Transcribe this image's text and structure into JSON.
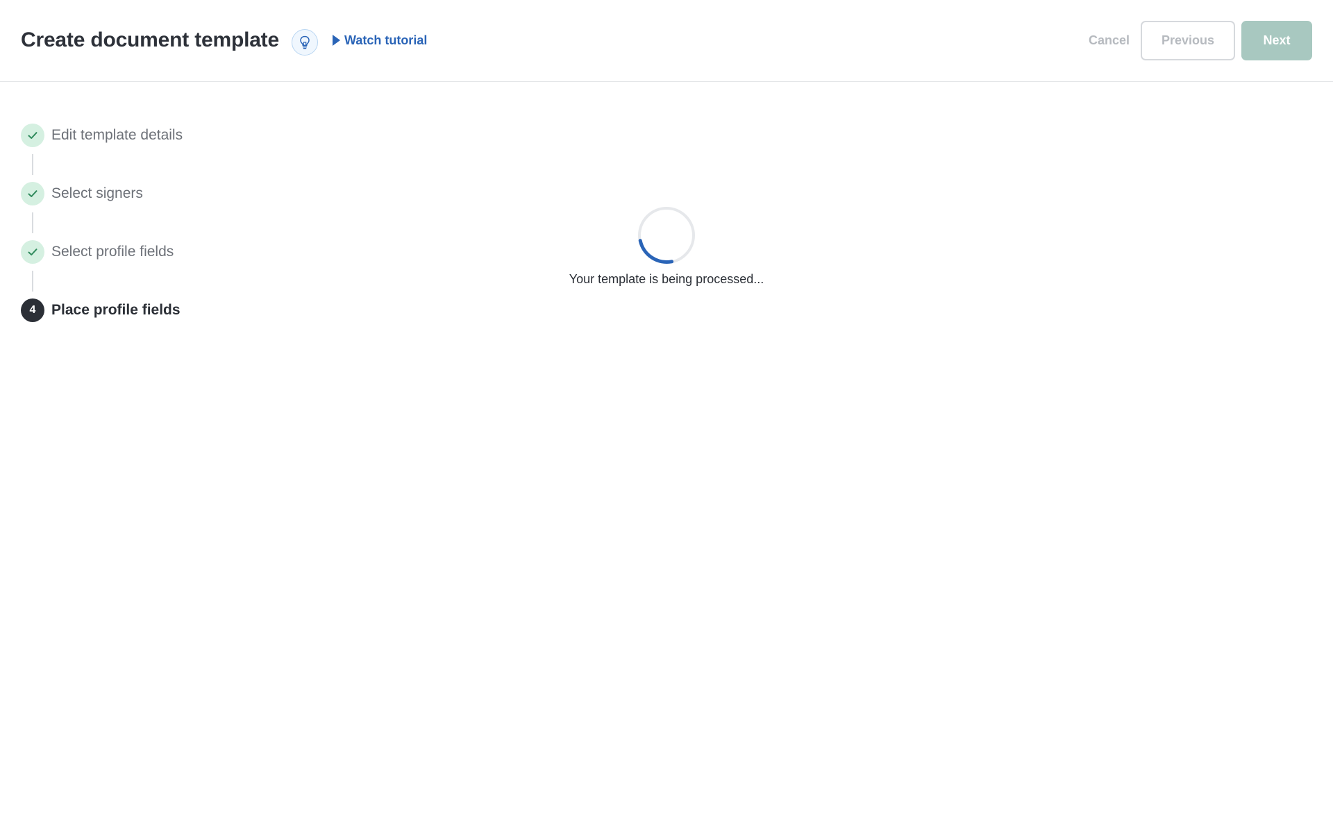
{
  "header": {
    "title": "Create document template",
    "tutorial_label": "Watch tutorial",
    "cancel_label": "Cancel",
    "previous_label": "Previous",
    "next_label": "Next"
  },
  "steps": [
    {
      "label": "Edit template details",
      "status": "done"
    },
    {
      "label": "Select signers",
      "status": "done"
    },
    {
      "label": "Select profile fields",
      "status": "done"
    },
    {
      "label": "Place profile fields",
      "status": "current",
      "number": "4"
    }
  ],
  "main": {
    "status_text": "Your template is being processed..."
  },
  "colors": {
    "accent": "#2a64b7",
    "next_button": "#a8c8c0",
    "done_step": "#d5f0e1",
    "check": "#2f8a5c"
  }
}
